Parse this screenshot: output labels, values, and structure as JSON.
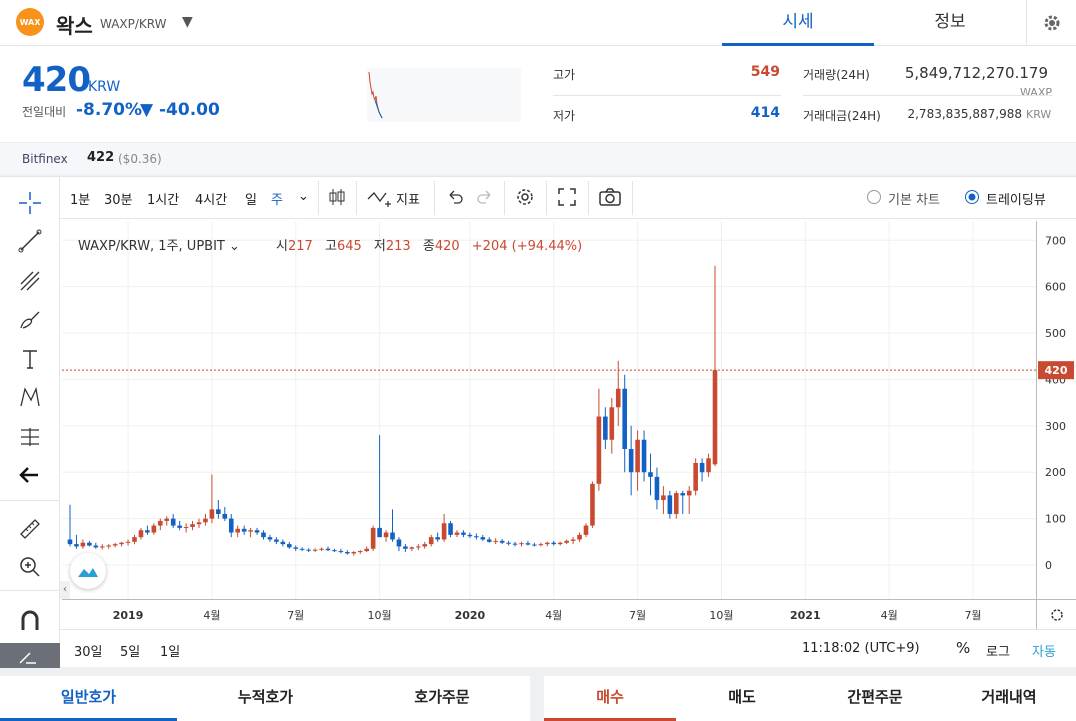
{
  "header": {
    "logo_text": "WAX",
    "coin_name": "왁스",
    "pair": "WAXP/KRW",
    "tabs": [
      "시세",
      "정보"
    ]
  },
  "price": {
    "current": "420",
    "unit": "KRW",
    "prev_label": "전일대비",
    "change_pct": "-8.70%",
    "change_amount": "▼ -40.00",
    "high_label": "고가",
    "high": "549",
    "low_label": "저가",
    "low": "414",
    "volume_label": "거래량(24H)",
    "volume": "5,849,712,270.179",
    "volume_unit": "WAXP",
    "value_label": "거래대금(24H)",
    "value": "2,783,835,887,988",
    "value_unit": "KRW"
  },
  "exchange": {
    "name": "Bitfinex",
    "price": "422",
    "usd": "($0.36)"
  },
  "toolbar": {
    "intervals": [
      "1분",
      "30분",
      "1시간",
      "4시간",
      "일",
      "주"
    ],
    "indicator_label": "지표",
    "basic_chart_label": "기본 차트",
    "tradingview_label": "트레이딩뷰"
  },
  "legend": {
    "symbol": "WAXP/KRW, 1주, UPBIT",
    "open_label": "시",
    "open": "217",
    "high_label": "고",
    "high": "645",
    "low_label": "저",
    "low": "213",
    "close_label": "종",
    "close": "420",
    "change": "+204 (+94.44%)"
  },
  "bottom_bar": {
    "ranges": [
      "30일",
      "5일",
      "1일"
    ],
    "time": "11:18:02 (UTC+9)",
    "percent": "%",
    "log": "로그",
    "auto": "자동"
  },
  "order_tabs": [
    "일반호가",
    "누적호가",
    "호가주문"
  ],
  "trade_tabs": [
    "매수",
    "매도",
    "간편주문",
    "거래내역"
  ],
  "colors": {
    "up": "#c84a31",
    "down": "#1261c4",
    "accent": "#1261c4",
    "buy": "#c84a31"
  },
  "chart_data": {
    "type": "candlestick",
    "interval": "1주",
    "symbol": "WAXP/KRW",
    "ylim": [
      0,
      720
    ],
    "yticks": [
      0,
      100,
      200,
      300,
      400,
      500,
      600,
      700
    ],
    "last_price_label": "420",
    "xticks": [
      "2019",
      "4월",
      "7월",
      "10월",
      "2020",
      "4월",
      "7월",
      "10월",
      "2021",
      "4월",
      "7월"
    ],
    "xtick_week_index": [
      9,
      22,
      35,
      48,
      62,
      75,
      88,
      101,
      114,
      127,
      140
    ],
    "candles": [
      [
        55,
        130,
        40,
        45
      ],
      [
        45,
        65,
        35,
        40
      ],
      [
        40,
        55,
        35,
        48
      ],
      [
        48,
        52,
        40,
        42
      ],
      [
        42,
        48,
        35,
        38
      ],
      [
        38,
        45,
        33,
        40
      ],
      [
        40,
        45,
        35,
        42
      ],
      [
        42,
        48,
        38,
        45
      ],
      [
        45,
        50,
        40,
        48
      ],
      [
        48,
        55,
        42,
        50
      ],
      [
        50,
        65,
        45,
        60
      ],
      [
        60,
        80,
        55,
        75
      ],
      [
        75,
        85,
        65,
        70
      ],
      [
        70,
        90,
        65,
        85
      ],
      [
        85,
        100,
        75,
        95
      ],
      [
        95,
        105,
        85,
        100
      ],
      [
        100,
        110,
        80,
        85
      ],
      [
        85,
        95,
        75,
        80
      ],
      [
        80,
        90,
        70,
        82
      ],
      [
        82,
        95,
        75,
        88
      ],
      [
        88,
        100,
        80,
        92
      ],
      [
        92,
        110,
        85,
        100
      ],
      [
        100,
        195,
        90,
        120
      ],
      [
        120,
        140,
        100,
        110
      ],
      [
        110,
        125,
        95,
        100
      ],
      [
        100,
        110,
        60,
        70
      ],
      [
        70,
        85,
        60,
        78
      ],
      [
        78,
        85,
        65,
        72
      ],
      [
        72,
        80,
        60,
        75
      ],
      [
        75,
        80,
        65,
        70
      ],
      [
        70,
        75,
        55,
        60
      ],
      [
        60,
        65,
        50,
        55
      ],
      [
        55,
        60,
        45,
        50
      ],
      [
        50,
        55,
        40,
        45
      ],
      [
        45,
        50,
        35,
        38
      ],
      [
        38,
        42,
        30,
        35
      ],
      [
        35,
        38,
        30,
        33
      ],
      [
        33,
        36,
        28,
        32
      ],
      [
        32,
        36,
        28,
        33
      ],
      [
        33,
        38,
        30,
        35
      ],
      [
        35,
        40,
        30,
        32
      ],
      [
        32,
        35,
        28,
        30
      ],
      [
        30,
        35,
        25,
        28
      ],
      [
        28,
        32,
        22,
        25
      ],
      [
        25,
        30,
        20,
        28
      ],
      [
        28,
        32,
        24,
        30
      ],
      [
        30,
        40,
        28,
        35
      ],
      [
        35,
        85,
        30,
        80
      ],
      [
        80,
        280,
        60,
        60
      ],
      [
        60,
        75,
        50,
        70
      ],
      [
        70,
        120,
        50,
        55
      ],
      [
        55,
        60,
        30,
        40
      ],
      [
        40,
        45,
        28,
        35
      ],
      [
        35,
        40,
        30,
        38
      ],
      [
        38,
        45,
        32,
        40
      ],
      [
        40,
        50,
        35,
        45
      ],
      [
        45,
        65,
        40,
        60
      ],
      [
        60,
        70,
        50,
        55
      ],
      [
        55,
        110,
        50,
        90
      ],
      [
        90,
        95,
        60,
        65
      ],
      [
        65,
        75,
        60,
        70
      ],
      [
        70,
        75,
        60,
        65
      ],
      [
        65,
        70,
        58,
        62
      ],
      [
        62,
        68,
        55,
        60
      ],
      [
        60,
        65,
        52,
        55
      ],
      [
        55,
        60,
        48,
        50
      ],
      [
        50,
        58,
        45,
        52
      ],
      [
        52,
        56,
        45,
        48
      ],
      [
        48,
        52,
        42,
        46
      ],
      [
        46,
        50,
        40,
        45
      ],
      [
        45,
        50,
        40,
        47
      ],
      [
        47,
        52,
        42,
        44
      ],
      [
        44,
        48,
        40,
        43
      ],
      [
        43,
        48,
        40,
        45
      ],
      [
        45,
        50,
        40,
        48
      ],
      [
        48,
        52,
        42,
        45
      ],
      [
        45,
        50,
        42,
        48
      ],
      [
        48,
        55,
        45,
        52
      ],
      [
        52,
        60,
        45,
        55
      ],
      [
        55,
        70,
        50,
        65
      ],
      [
        65,
        90,
        60,
        85
      ],
      [
        85,
        180,
        80,
        175
      ],
      [
        175,
        380,
        160,
        320
      ],
      [
        320,
        340,
        250,
        270
      ],
      [
        270,
        360,
        240,
        340
      ],
      [
        340,
        440,
        300,
        380
      ],
      [
        380,
        410,
        200,
        250
      ],
      [
        250,
        300,
        150,
        200
      ],
      [
        200,
        290,
        160,
        270
      ],
      [
        270,
        290,
        180,
        200
      ],
      [
        200,
        240,
        150,
        190
      ],
      [
        190,
        210,
        120,
        140
      ],
      [
        140,
        170,
        110,
        150
      ],
      [
        150,
        160,
        100,
        110
      ],
      [
        110,
        160,
        100,
        155
      ],
      [
        155,
        160,
        110,
        150
      ],
      [
        150,
        170,
        110,
        160
      ],
      [
        160,
        230,
        150,
        220
      ],
      [
        220,
        230,
        180,
        200
      ],
      [
        200,
        240,
        190,
        230
      ],
      [
        217,
        645,
        213,
        420
      ]
    ]
  }
}
